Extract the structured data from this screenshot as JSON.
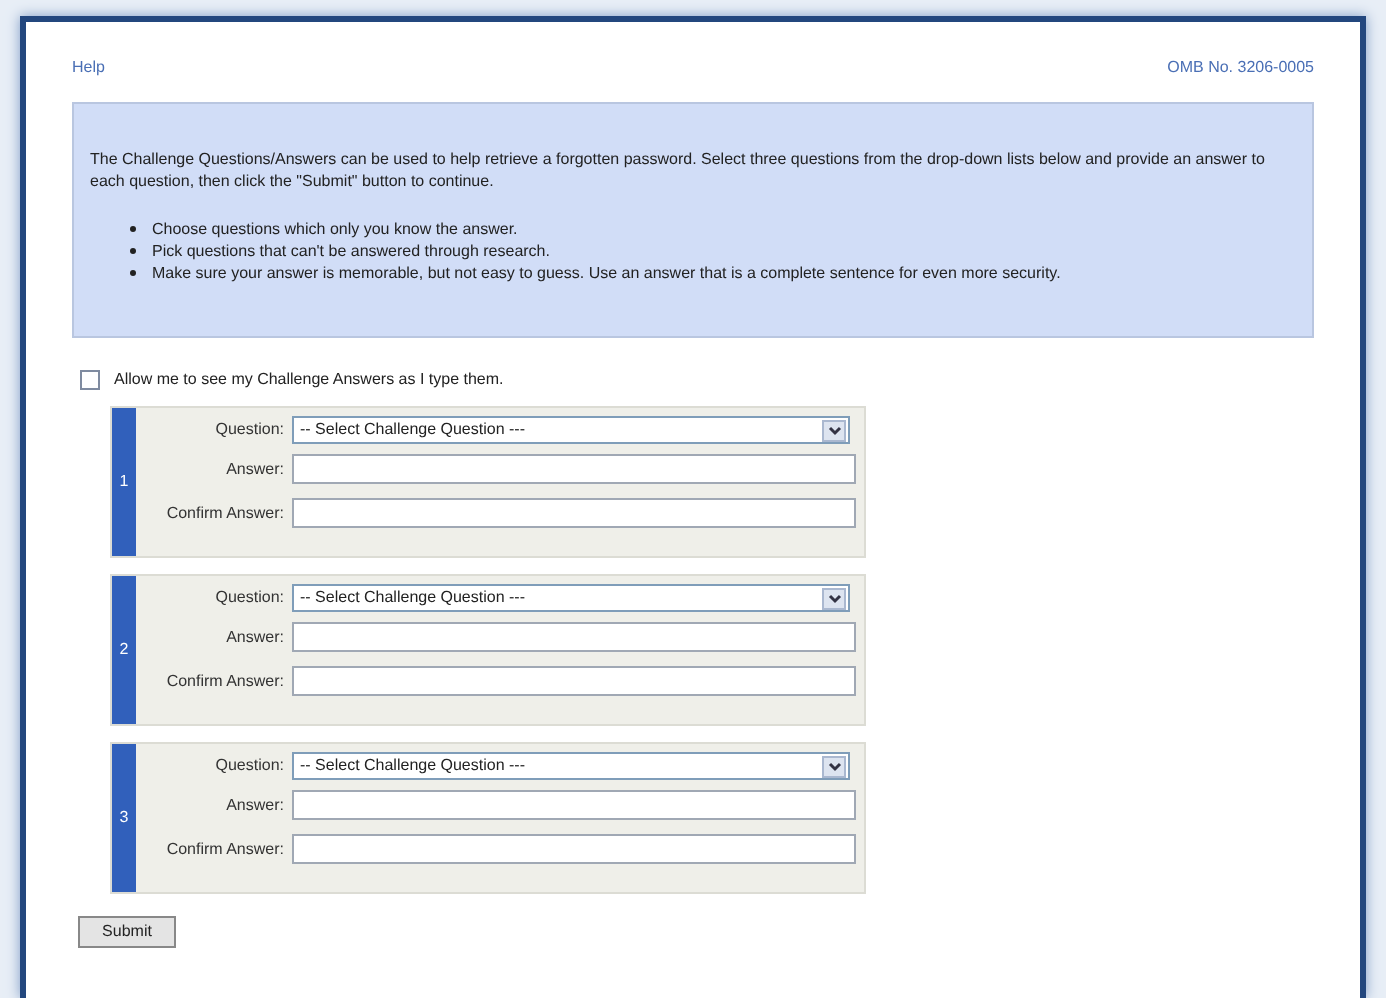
{
  "header": {
    "help_link": "Help",
    "omb_number": "OMB No. 3206-0005"
  },
  "info": {
    "intro": "The Challenge Questions/Answers can be used to help retrieve a forgotten password. Select three questions from the drop-down lists below and provide an answer to each question, then click the \"Submit\" button to continue.",
    "tips": [
      "Choose questions which only you know the answer.",
      "Pick questions that can't be answered through research.",
      "Make sure your answer is memorable, but not easy to guess. Use an answer that is a complete sentence for even more security."
    ]
  },
  "show_answers": {
    "label": "Allow me to see my Challenge Answers as I type them.",
    "checked": false
  },
  "questions": [
    {
      "number": "1",
      "question_label": "Question:",
      "question_value": "-- Select Challenge Question ---",
      "answer_label": "Answer:",
      "confirm_label": "Confirm Answer:"
    },
    {
      "number": "2",
      "question_label": "Question:",
      "question_value": "-- Select Challenge Question ---",
      "answer_label": "Answer:",
      "confirm_label": "Confirm Answer:"
    },
    {
      "number": "3",
      "question_label": "Question:",
      "question_value": "-- Select Challenge Question ---",
      "answer_label": "Answer:",
      "confirm_label": "Confirm Answer:"
    }
  ],
  "submit": "Submit"
}
